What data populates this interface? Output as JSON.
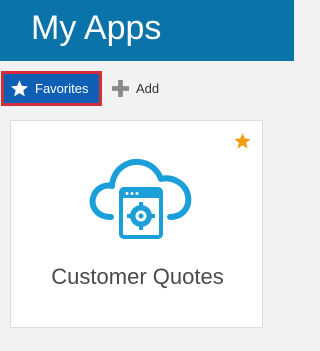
{
  "header": {
    "title": "My Apps"
  },
  "toolbar": {
    "favorites_label": "Favorites",
    "add_label": "Add"
  },
  "apps": [
    {
      "name": "Customer Quotes",
      "icon": "cloud-window-gear-icon",
      "favorite": true
    }
  ],
  "colors": {
    "header_bg": "#0a73a9",
    "favorites_bg": "#0f5fb4",
    "highlight_border": "#d32f3a",
    "favorite_star": "#f39c12",
    "app_icon": "#1a9fd9"
  },
  "icons": {
    "favorites": "star-icon",
    "add": "plus-icon",
    "card_favorite": "star-icon"
  }
}
